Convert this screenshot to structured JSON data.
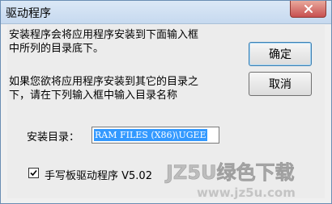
{
  "window": {
    "title": "驱动程序",
    "close_glyph": "✕"
  },
  "dialog": {
    "message_line1": "安装程序会将应用程序安装到下面输入框",
    "message_line2": "中所列的目录底下。",
    "message_line3": "如果您欲将应用程序安装到其它的目录之",
    "message_line4": "下，请在下列输入框中输入目录名称",
    "ok_label": "确定",
    "cancel_label": "取消",
    "install_dir_label": "安装目录：",
    "install_dir_value": "RAM FILES (X86)\\UGEE",
    "checkbox_label": "手写板驱动程序 V5.02",
    "checkbox_checked": true
  },
  "watermark": {
    "brand": "JZ5U绿色下载",
    "url": "www.jz5u.com"
  },
  "colors": {
    "accent_selection": "#3399ff",
    "close_button": "#c75050",
    "watermark": "#b9b9b9"
  }
}
